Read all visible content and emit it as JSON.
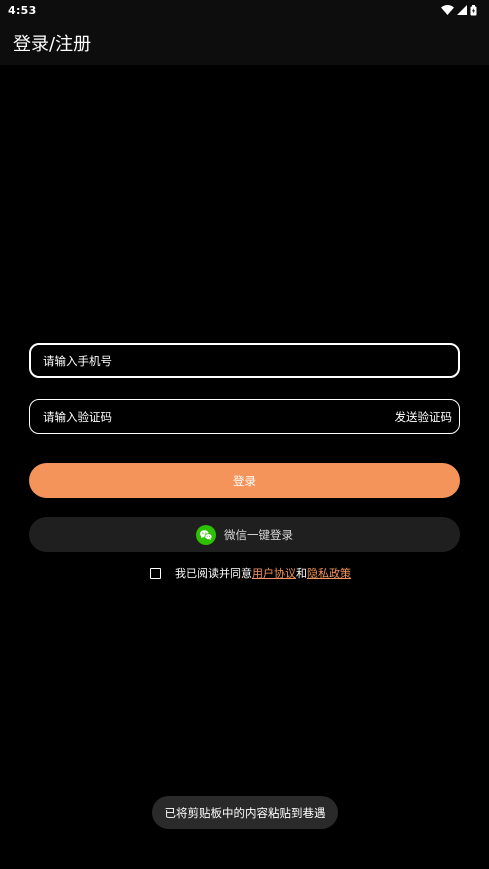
{
  "status_bar": {
    "time": "4:53",
    "icons": [
      "wifi-icon",
      "signal-icon",
      "battery-icon"
    ]
  },
  "app_bar": {
    "title": "登录/注册"
  },
  "form": {
    "phone_placeholder": "请输入手机号",
    "code_placeholder": "请输入验证码",
    "send_code_label": "发送验证码",
    "login_label": "登录",
    "wechat_login_label": "微信一键登录"
  },
  "agreement": {
    "prefix": "我已阅读并同意",
    "user_agreement": "用户协议",
    "conjunction": "和",
    "privacy_policy": "隐私政策",
    "checked": false
  },
  "toast": {
    "message": "已将剪贴板中的内容粘贴到巷遇"
  },
  "colors": {
    "background": "#000000",
    "accent": "#f5945a",
    "wechat_green": "#2dc100",
    "secondary_button": "#1f1f1f"
  }
}
